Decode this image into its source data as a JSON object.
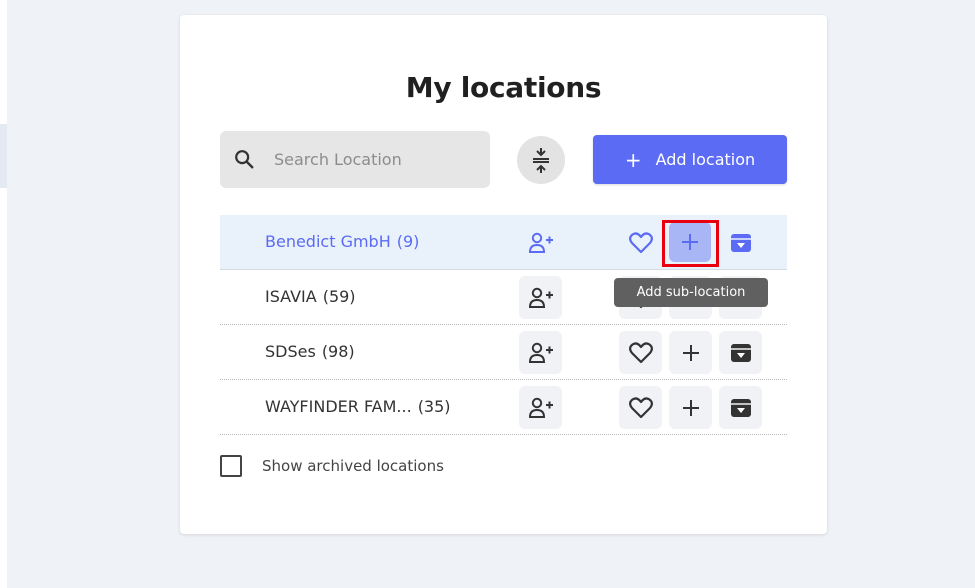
{
  "page": {
    "title": "My locations",
    "search_placeholder": "Search Location",
    "add_button_label": "Add location",
    "add_button_icon": "+",
    "show_archived_label": "Show archived locations",
    "tooltip": "Add sub-location"
  },
  "locations": [
    {
      "name": "Benedict GmbH",
      "count": "(9)"
    },
    {
      "name": "ISAVIA",
      "count": "(59)"
    },
    {
      "name": "SDSes",
      "count": "(98)"
    },
    {
      "name": "WAYFINDER FAM...",
      "count": "(35)"
    }
  ],
  "colors": {
    "accent": "#5b6bf4",
    "highlight": "#e8000f",
    "selected_row": "#e9f1fb"
  }
}
